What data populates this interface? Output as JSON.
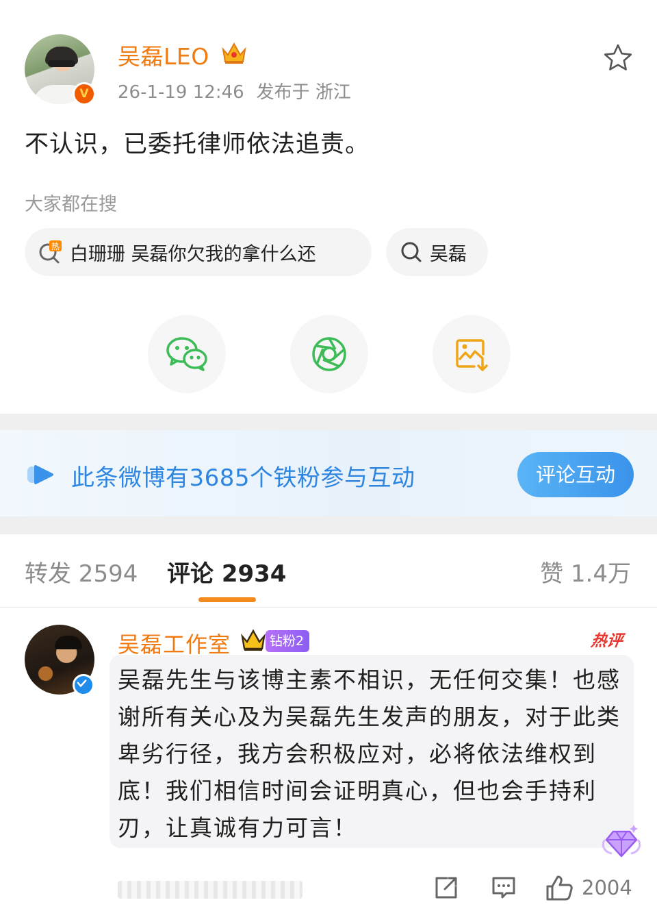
{
  "post": {
    "author": "吴磊LEO",
    "timestamp": "26-1-19 12:46",
    "location": "发布于 浙江",
    "text": "不认识，已委托律师依法追责。",
    "author_icons": [
      "avatar",
      "verified-badge-icon",
      "crown-icon",
      "star-icon"
    ]
  },
  "search": {
    "heading": "大家都在搜",
    "chips": [
      {
        "label": "白珊珊 吴磊你欠我的拿什么还",
        "icon": "hot-search-icon"
      },
      {
        "label": "吴磊",
        "icon": "search-icon"
      }
    ]
  },
  "share": {
    "buttons": [
      "wechat-icon",
      "moments-icon",
      "save-image-icon"
    ]
  },
  "banner": {
    "text": "此条微博有3685个铁粉参与互动",
    "button": "评论互动"
  },
  "tabs": {
    "forward": "转发 2594",
    "comments": "评论 2934",
    "likes": "赞 1.4万"
  },
  "comment": {
    "author": "吴磊工作室",
    "fan_badge": "钻粉2",
    "hot_tag": "热评",
    "text": "吴磊先生与该博主素不相识，无任何交集！也感谢所有关心及为吴磊先生发声的朋友，对于此类卑劣行径，我方会积极应对，必将依法维权到底！我们相信时间会证明真心，但也会手持利刃，让真诚有力可言！",
    "like_count": "2004"
  },
  "colors": {
    "username": "#f07b12",
    "accent_blue": "#2f86e0",
    "tab_underline": "#f58a1f",
    "hot": "#e8362e"
  }
}
